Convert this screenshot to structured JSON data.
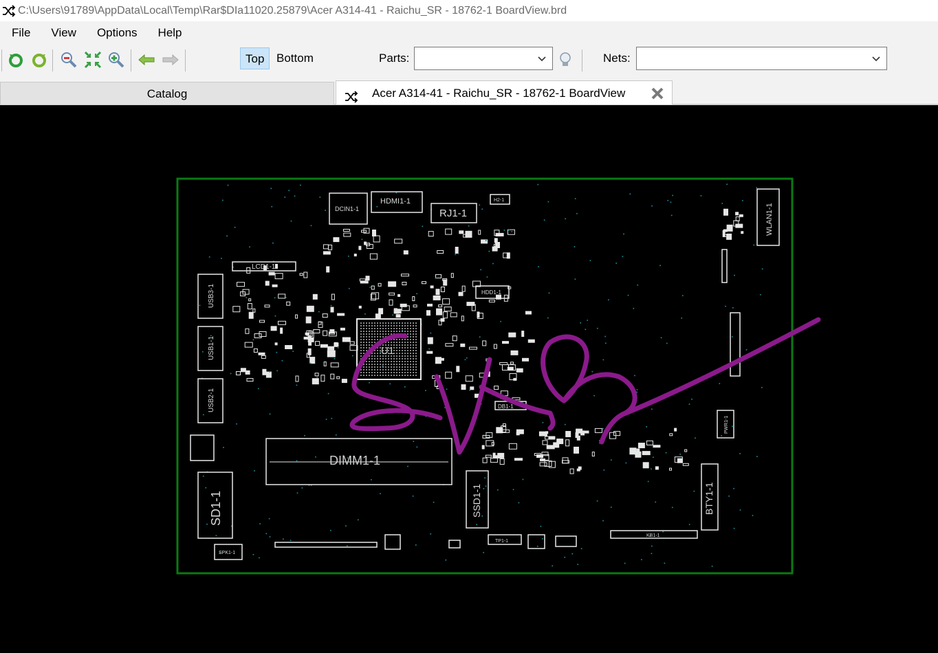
{
  "window": {
    "title": "C:\\Users\\91789\\AppData\\Local\\Temp\\Rar$DIa11020.25879\\Acer A314-41 - Raichu_SR - 18762-1 BoardView.brd",
    "app_icon": "crossed-arrows-icon"
  },
  "menu": {
    "items": [
      "File",
      "View",
      "Options",
      "Help"
    ]
  },
  "toolbar": {
    "buttons": [
      "rotate-left-icon",
      "rotate-right-icon",
      "zoom-out-icon",
      "fit-icon",
      "zoom-in-icon",
      "back-arrow-icon",
      "forward-arrow-icon"
    ],
    "top_label": "Top",
    "bottom_label": "Bottom",
    "parts_label": "Parts:",
    "parts_value": "",
    "nets_label": "Nets:",
    "nets_value": ""
  },
  "tabs": {
    "catalog": "Catalog",
    "board": "Acer A314-41 - Raichu_SR - 18762-1 BoardView"
  },
  "board": {
    "outline_color": "#0a7a12",
    "silk_color": "#e8e8e8",
    "annotation_color": "#8b1a8b",
    "labels": {
      "dimm": "DIMM1-1",
      "hdmi": "HDMI1-1",
      "rj": "RJ1-1",
      "dcin": "DCIN1-1",
      "lcd": "LCD1-1",
      "usb3": "USB3-1",
      "usb1": "USB1-1",
      "usb2": "USB2-1",
      "sd": "SD1-1",
      "ssd": "SSD1-1",
      "wlan": "WLAN1-1",
      "bty": "BTY1-1",
      "spk": "SPK1-1",
      "u1": "U1",
      "hdd": "HDD1-1",
      "h2": "H2-1",
      "db": "DB1-1",
      "pwr": "PWR1-1",
      "tp": "TP1-1",
      "kb": "KB1-1"
    }
  }
}
